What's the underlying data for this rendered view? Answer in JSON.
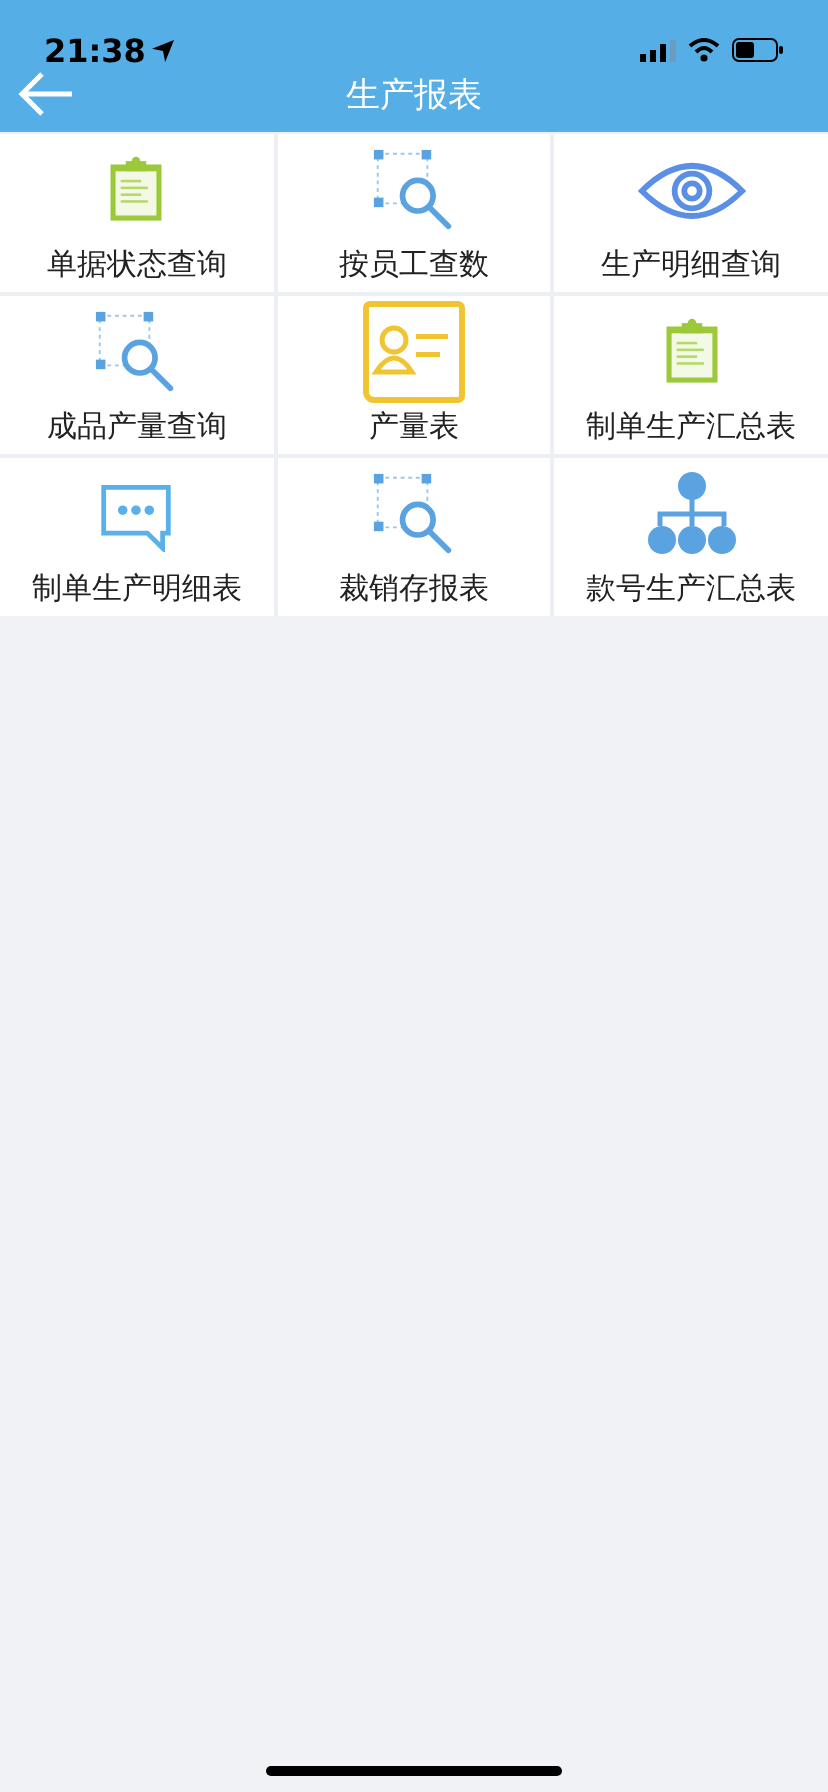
{
  "status_bar": {
    "time": "21:38"
  },
  "header": {
    "title": "生产报表"
  },
  "reports": [
    {
      "label": "单据状态查询",
      "kind": "clipboard"
    },
    {
      "label": "按员工查数",
      "kind": "scan"
    },
    {
      "label": "生产明细查询",
      "kind": "eye"
    },
    {
      "label": "成品产量查询",
      "kind": "scan"
    },
    {
      "label": "产量表",
      "kind": "card"
    },
    {
      "label": "制单生产汇总表",
      "kind": "clipboard"
    },
    {
      "label": "制单生产明细表",
      "kind": "chat"
    },
    {
      "label": "裁销存报表",
      "kind": "scan"
    },
    {
      "label": "款号生产汇总表",
      "kind": "tree"
    }
  ]
}
